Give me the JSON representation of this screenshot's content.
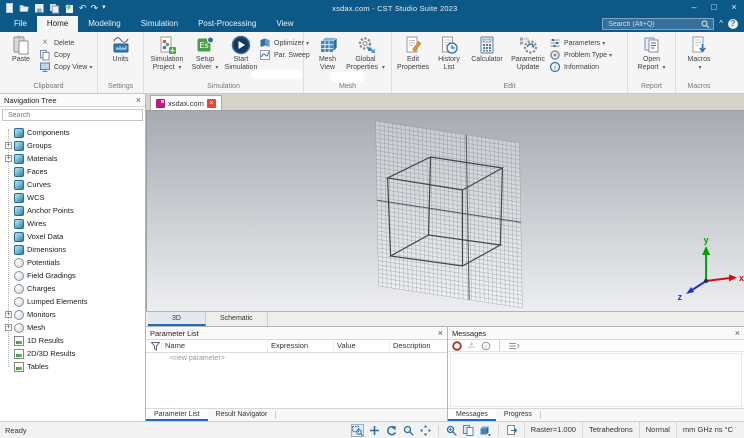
{
  "titlebar": {
    "title": "xsdax.com - CST Studio Suite 2023"
  },
  "window_controls": {
    "minimize": "–",
    "maximize": "□",
    "close": "×"
  },
  "icons": {
    "dropdown": "▾",
    "undo": "↶",
    "redo": "↷",
    "overflow": "⋯",
    "collapse": "^",
    "help": "?",
    "close": "×",
    "warning": "⚠",
    "info": "i",
    "expand": "+"
  },
  "menubar": {
    "tabs": [
      {
        "label": "File",
        "cls": ""
      },
      {
        "label": "Home",
        "cls": "active"
      },
      {
        "label": "Modeling",
        "cls": ""
      },
      {
        "label": "Simulation",
        "cls": ""
      },
      {
        "label": "Post-Processing",
        "cls": ""
      },
      {
        "label": "View",
        "cls": ""
      }
    ],
    "search_placeholder": "Search (Alt+Q)"
  },
  "ribbon": {
    "clipboard": {
      "label": "Clipboard",
      "paste": "Paste",
      "delete": "Delete",
      "copy": "Copy",
      "copy_view": "Copy View"
    },
    "settings": {
      "label": "Settings",
      "units": "Units"
    },
    "simulation": {
      "label": "Simulation",
      "sim_project_1": "Simulation",
      "sim_project_2": "Project",
      "setup_solver_1": "Setup",
      "setup_solver_2": "Solver",
      "start_sim_1": "Start",
      "start_sim_2": "Simulation",
      "optimizer": "Optimizer",
      "par_sweep": "Par. Sweep"
    },
    "mesh": {
      "label": "Mesh",
      "mesh_view_1": "Mesh",
      "mesh_view_2": "View",
      "global_props_1": "Global",
      "global_props_2": "Properties"
    },
    "edit": {
      "label": "Edit",
      "edit_props_1": "Edit",
      "edit_props_2": "Properties",
      "history_1": "History",
      "history_2": "List",
      "calculator": "Calculator",
      "parametric_1": "Parametric",
      "parametric_2": "Update",
      "parameters": "Parameters",
      "problem_type": "Problem Type",
      "information": "Information"
    },
    "report": {
      "label": "Report",
      "open_report_1": "Open",
      "open_report_2": "Report"
    },
    "macros": {
      "label": "Macros",
      "macros_1": "Macros"
    }
  },
  "nav": {
    "title": "Navigation Tree",
    "search_placeholder": "Search",
    "items": [
      {
        "label": "Components",
        "icon": "cube",
        "expander": ""
      },
      {
        "label": "Groups",
        "icon": "cube",
        "expander": "+"
      },
      {
        "label": "Materials",
        "icon": "cube",
        "expander": "+"
      },
      {
        "label": "Faces",
        "icon": "cube",
        "expander": ""
      },
      {
        "label": "Curves",
        "icon": "cube",
        "expander": ""
      },
      {
        "label": "WCS",
        "icon": "cube",
        "expander": ""
      },
      {
        "label": "Anchor Points",
        "icon": "cube",
        "expander": ""
      },
      {
        "label": "Wires",
        "icon": "cube",
        "expander": ""
      },
      {
        "label": "Voxel Data",
        "icon": "cube",
        "expander": ""
      },
      {
        "label": "Dimensions",
        "icon": "cube",
        "expander": ""
      },
      {
        "label": "Potentials",
        "icon": "circle",
        "expander": ""
      },
      {
        "label": "Field Gradings",
        "icon": "circle",
        "expander": ""
      },
      {
        "label": "Charges",
        "icon": "circle",
        "expander": ""
      },
      {
        "label": "Lumped Elements",
        "icon": "circle",
        "expander": ""
      },
      {
        "label": "Monitors",
        "icon": "circle",
        "expander": "+"
      },
      {
        "label": "Mesh",
        "icon": "circle",
        "expander": "+"
      },
      {
        "label": "1D Results",
        "icon": "chart",
        "expander": ""
      },
      {
        "label": "2D/3D Results",
        "icon": "chart",
        "expander": ""
      },
      {
        "label": "Tables",
        "icon": "chart",
        "expander": ""
      }
    ]
  },
  "document_tab": {
    "label": "xsdax.com"
  },
  "viewport": {
    "axes": {
      "x": "x",
      "y": "y",
      "z": "z"
    }
  },
  "view_tabs": {
    "t3d": "3D",
    "schematic": "Schematic"
  },
  "param_panel": {
    "title": "Parameter List",
    "columns": {
      "name": "Name",
      "expression": "Expression",
      "value": "Value",
      "description": "Description"
    },
    "new_param": "<new parameter>",
    "tab1": "Parameter List",
    "tab2": "Result Navigator"
  },
  "msg_panel": {
    "title": "Messages",
    "tab1": "Messages",
    "tab2": "Progress"
  },
  "statusbar": {
    "ready": "Ready",
    "raster": "Raster=1.000",
    "mesh": "Tetrahedrons",
    "quality": "Normal",
    "units": "mm GHz ns °C"
  }
}
